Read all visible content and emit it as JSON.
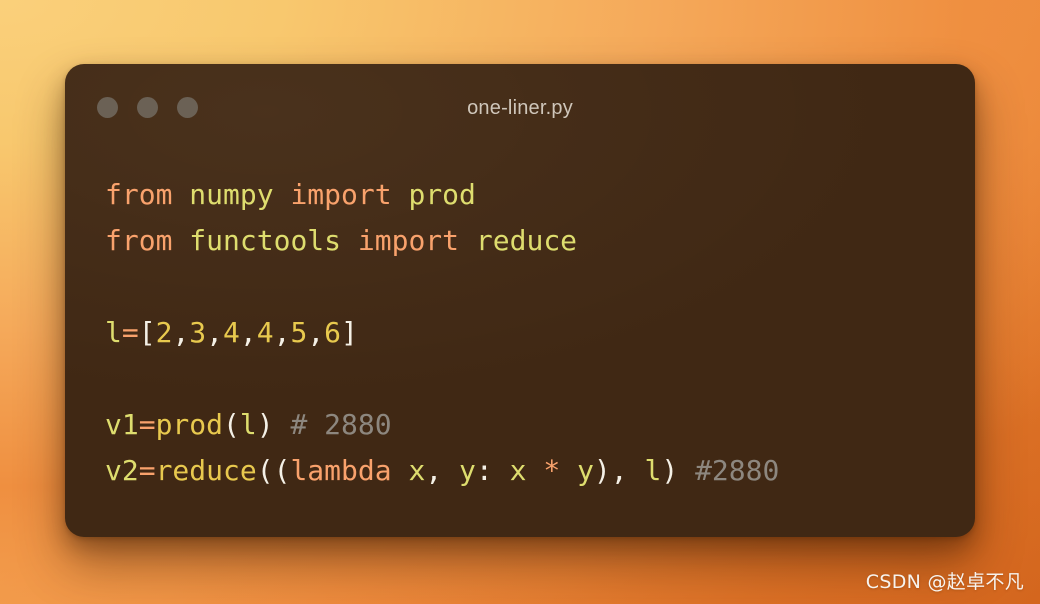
{
  "background": {
    "gradient_start": "#f9cd76",
    "gradient_mid": "#f0913f",
    "gradient_end": "#d96c22"
  },
  "card": {
    "background_color": "#402814",
    "title": "one-liner.py",
    "traffic_lights": [
      {
        "name": "close",
        "color": "#6b6155"
      },
      {
        "name": "minimize",
        "color": "#6b6155"
      },
      {
        "name": "maximize",
        "color": "#6b6155"
      }
    ]
  },
  "code": {
    "language": "python",
    "font_size_px": 28,
    "lines": [
      {
        "index": 1,
        "text": "from numpy import prod",
        "tokens": [
          {
            "text": "from",
            "type": "keyword"
          },
          {
            "text": " ",
            "type": "plain"
          },
          {
            "text": "numpy",
            "type": "name"
          },
          {
            "text": " ",
            "type": "plain"
          },
          {
            "text": "import",
            "type": "keyword"
          },
          {
            "text": " ",
            "type": "plain"
          },
          {
            "text": "prod",
            "type": "name"
          }
        ]
      },
      {
        "index": 2,
        "text": "from functools import reduce",
        "tokens": [
          {
            "text": "from",
            "type": "keyword"
          },
          {
            "text": " ",
            "type": "plain"
          },
          {
            "text": "functools",
            "type": "name"
          },
          {
            "text": " ",
            "type": "plain"
          },
          {
            "text": "import",
            "type": "keyword"
          },
          {
            "text": " ",
            "type": "plain"
          },
          {
            "text": "reduce",
            "type": "name"
          }
        ]
      },
      {
        "index": 3,
        "text": "",
        "tokens": []
      },
      {
        "index": 4,
        "text": "l=[2,3,4,4,5,6]",
        "tokens": [
          {
            "text": "l",
            "type": "name"
          },
          {
            "text": "=",
            "type": "op"
          },
          {
            "text": "[",
            "type": "punct"
          },
          {
            "text": "2",
            "type": "number"
          },
          {
            "text": ",",
            "type": "punct"
          },
          {
            "text": "3",
            "type": "number"
          },
          {
            "text": ",",
            "type": "punct"
          },
          {
            "text": "4",
            "type": "number"
          },
          {
            "text": ",",
            "type": "punct"
          },
          {
            "text": "4",
            "type": "number"
          },
          {
            "text": ",",
            "type": "punct"
          },
          {
            "text": "5",
            "type": "number"
          },
          {
            "text": ",",
            "type": "punct"
          },
          {
            "text": "6",
            "type": "number"
          },
          {
            "text": "]",
            "type": "punct"
          }
        ]
      },
      {
        "index": 5,
        "text": "",
        "tokens": []
      },
      {
        "index": 6,
        "text": "v1=prod(l) # 2880",
        "tokens": [
          {
            "text": "v1",
            "type": "name"
          },
          {
            "text": "=",
            "type": "op"
          },
          {
            "text": "prod",
            "type": "func"
          },
          {
            "text": "(",
            "type": "punct"
          },
          {
            "text": "l",
            "type": "name"
          },
          {
            "text": ")",
            "type": "punct"
          },
          {
            "text": " ",
            "type": "plain"
          },
          {
            "text": "# 2880",
            "type": "comment"
          }
        ]
      },
      {
        "index": 7,
        "text": "v2=reduce((lambda x, y: x * y), l) #2880",
        "tokens": [
          {
            "text": "v2",
            "type": "name"
          },
          {
            "text": "=",
            "type": "op"
          },
          {
            "text": "reduce",
            "type": "func"
          },
          {
            "text": "((",
            "type": "punct"
          },
          {
            "text": "lambda",
            "type": "keyword"
          },
          {
            "text": " ",
            "type": "plain"
          },
          {
            "text": "x",
            "type": "name"
          },
          {
            "text": ", ",
            "type": "punct"
          },
          {
            "text": "y",
            "type": "name"
          },
          {
            "text": ": ",
            "type": "punct"
          },
          {
            "text": "x",
            "type": "name"
          },
          {
            "text": " ",
            "type": "plain"
          },
          {
            "text": "*",
            "type": "op"
          },
          {
            "text": " ",
            "type": "plain"
          },
          {
            "text": "y",
            "type": "name"
          },
          {
            "text": "), ",
            "type": "punct"
          },
          {
            "text": "l",
            "type": "name"
          },
          {
            "text": ")",
            "type": "punct"
          },
          {
            "text": " ",
            "type": "plain"
          },
          {
            "text": "#2880",
            "type": "comment"
          }
        ]
      }
    ]
  },
  "watermark": {
    "text": "CSDN @赵卓不凡"
  }
}
